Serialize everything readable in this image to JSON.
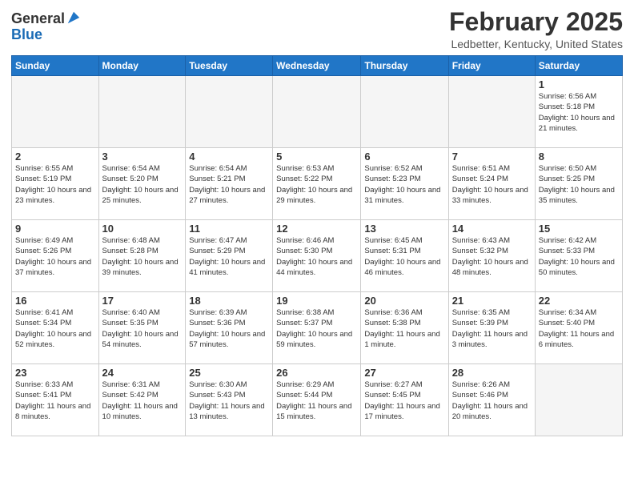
{
  "header": {
    "logo_general": "General",
    "logo_blue": "Blue",
    "month_title": "February 2025",
    "location": "Ledbetter, Kentucky, United States"
  },
  "weekdays": [
    "Sunday",
    "Monday",
    "Tuesday",
    "Wednesday",
    "Thursday",
    "Friday",
    "Saturday"
  ],
  "weeks": [
    [
      {
        "day": "",
        "info": ""
      },
      {
        "day": "",
        "info": ""
      },
      {
        "day": "",
        "info": ""
      },
      {
        "day": "",
        "info": ""
      },
      {
        "day": "",
        "info": ""
      },
      {
        "day": "",
        "info": ""
      },
      {
        "day": "1",
        "info": "Sunrise: 6:56 AM\nSunset: 5:18 PM\nDaylight: 10 hours and 21 minutes."
      }
    ],
    [
      {
        "day": "2",
        "info": "Sunrise: 6:55 AM\nSunset: 5:19 PM\nDaylight: 10 hours and 23 minutes."
      },
      {
        "day": "3",
        "info": "Sunrise: 6:54 AM\nSunset: 5:20 PM\nDaylight: 10 hours and 25 minutes."
      },
      {
        "day": "4",
        "info": "Sunrise: 6:54 AM\nSunset: 5:21 PM\nDaylight: 10 hours and 27 minutes."
      },
      {
        "day": "5",
        "info": "Sunrise: 6:53 AM\nSunset: 5:22 PM\nDaylight: 10 hours and 29 minutes."
      },
      {
        "day": "6",
        "info": "Sunrise: 6:52 AM\nSunset: 5:23 PM\nDaylight: 10 hours and 31 minutes."
      },
      {
        "day": "7",
        "info": "Sunrise: 6:51 AM\nSunset: 5:24 PM\nDaylight: 10 hours and 33 minutes."
      },
      {
        "day": "8",
        "info": "Sunrise: 6:50 AM\nSunset: 5:25 PM\nDaylight: 10 hours and 35 minutes."
      }
    ],
    [
      {
        "day": "9",
        "info": "Sunrise: 6:49 AM\nSunset: 5:26 PM\nDaylight: 10 hours and 37 minutes."
      },
      {
        "day": "10",
        "info": "Sunrise: 6:48 AM\nSunset: 5:28 PM\nDaylight: 10 hours and 39 minutes."
      },
      {
        "day": "11",
        "info": "Sunrise: 6:47 AM\nSunset: 5:29 PM\nDaylight: 10 hours and 41 minutes."
      },
      {
        "day": "12",
        "info": "Sunrise: 6:46 AM\nSunset: 5:30 PM\nDaylight: 10 hours and 44 minutes."
      },
      {
        "day": "13",
        "info": "Sunrise: 6:45 AM\nSunset: 5:31 PM\nDaylight: 10 hours and 46 minutes."
      },
      {
        "day": "14",
        "info": "Sunrise: 6:43 AM\nSunset: 5:32 PM\nDaylight: 10 hours and 48 minutes."
      },
      {
        "day": "15",
        "info": "Sunrise: 6:42 AM\nSunset: 5:33 PM\nDaylight: 10 hours and 50 minutes."
      }
    ],
    [
      {
        "day": "16",
        "info": "Sunrise: 6:41 AM\nSunset: 5:34 PM\nDaylight: 10 hours and 52 minutes."
      },
      {
        "day": "17",
        "info": "Sunrise: 6:40 AM\nSunset: 5:35 PM\nDaylight: 10 hours and 54 minutes."
      },
      {
        "day": "18",
        "info": "Sunrise: 6:39 AM\nSunset: 5:36 PM\nDaylight: 10 hours and 57 minutes."
      },
      {
        "day": "19",
        "info": "Sunrise: 6:38 AM\nSunset: 5:37 PM\nDaylight: 10 hours and 59 minutes."
      },
      {
        "day": "20",
        "info": "Sunrise: 6:36 AM\nSunset: 5:38 PM\nDaylight: 11 hours and 1 minute."
      },
      {
        "day": "21",
        "info": "Sunrise: 6:35 AM\nSunset: 5:39 PM\nDaylight: 11 hours and 3 minutes."
      },
      {
        "day": "22",
        "info": "Sunrise: 6:34 AM\nSunset: 5:40 PM\nDaylight: 11 hours and 6 minutes."
      }
    ],
    [
      {
        "day": "23",
        "info": "Sunrise: 6:33 AM\nSunset: 5:41 PM\nDaylight: 11 hours and 8 minutes."
      },
      {
        "day": "24",
        "info": "Sunrise: 6:31 AM\nSunset: 5:42 PM\nDaylight: 11 hours and 10 minutes."
      },
      {
        "day": "25",
        "info": "Sunrise: 6:30 AM\nSunset: 5:43 PM\nDaylight: 11 hours and 13 minutes."
      },
      {
        "day": "26",
        "info": "Sunrise: 6:29 AM\nSunset: 5:44 PM\nDaylight: 11 hours and 15 minutes."
      },
      {
        "day": "27",
        "info": "Sunrise: 6:27 AM\nSunset: 5:45 PM\nDaylight: 11 hours and 17 minutes."
      },
      {
        "day": "28",
        "info": "Sunrise: 6:26 AM\nSunset: 5:46 PM\nDaylight: 11 hours and 20 minutes."
      },
      {
        "day": "",
        "info": ""
      }
    ]
  ]
}
